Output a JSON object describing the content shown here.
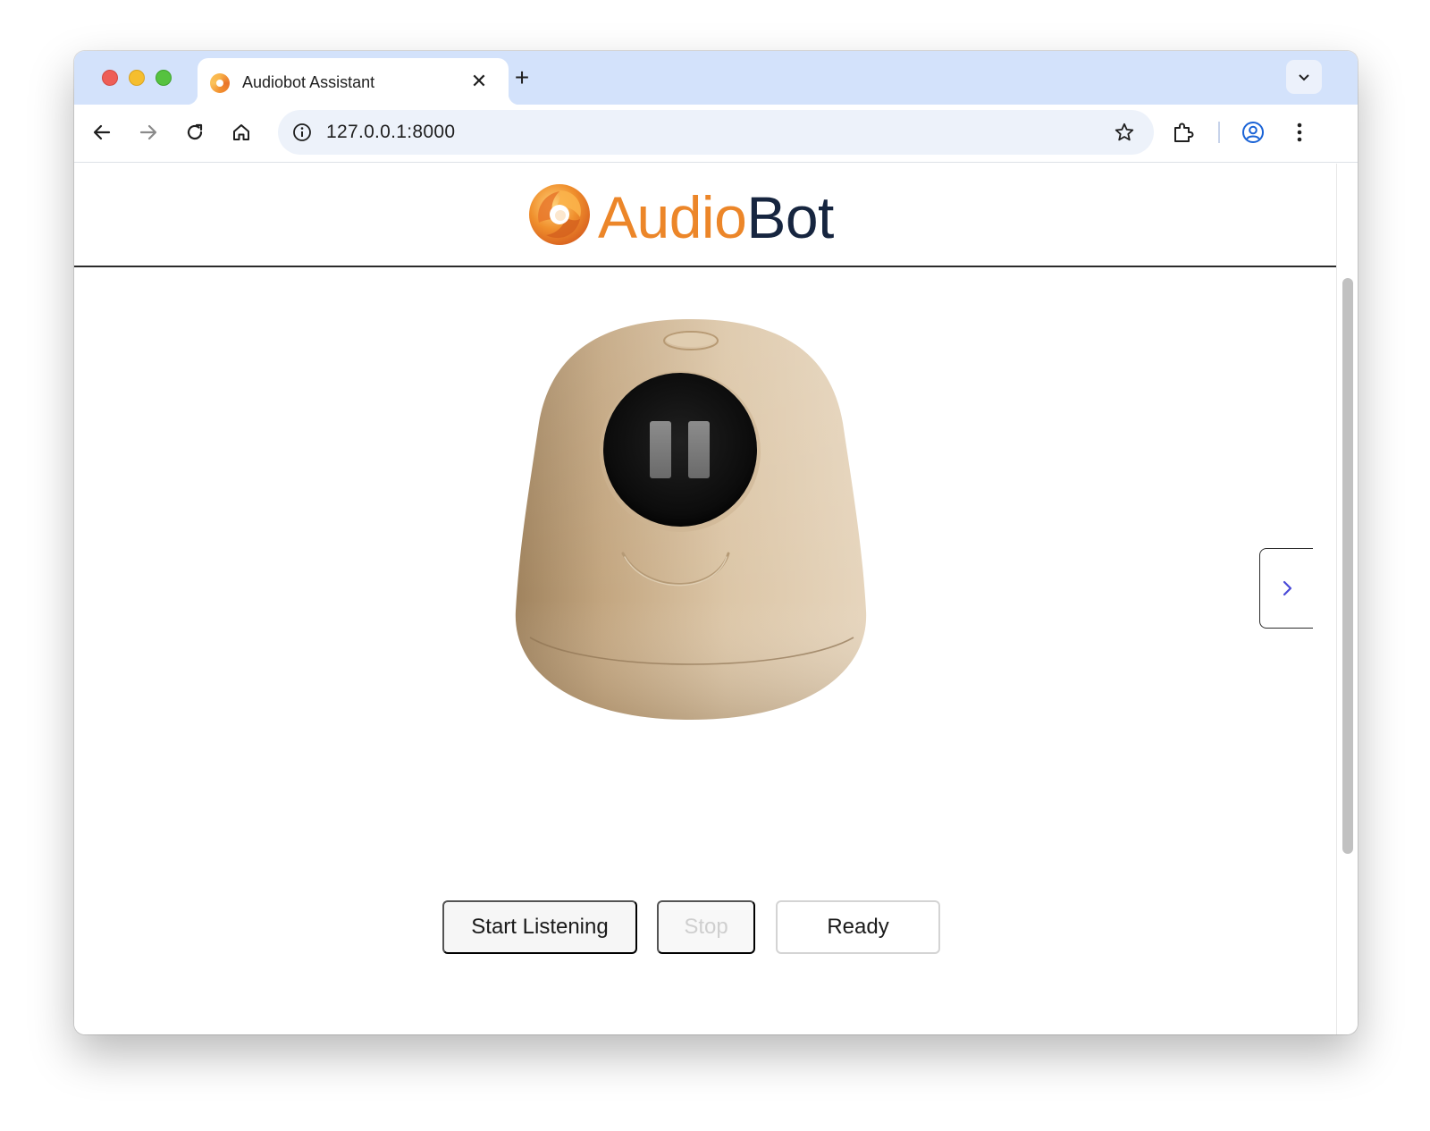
{
  "browser": {
    "tab": {
      "title": "Audiobot Assistant",
      "favicon": "audiobot-logo-icon"
    },
    "url": "127.0.0.1:8000",
    "icons": [
      "back-icon",
      "forward-icon",
      "reload-icon",
      "home-icon",
      "site-info-icon",
      "bookmark-star-icon",
      "extensions-icon",
      "profile-icon",
      "menu-icon",
      "tab-search-icon"
    ]
  },
  "header": {
    "logo_text_audio": "Audio",
    "logo_text_bot": "Bot"
  },
  "controls": {
    "start_label": "Start Listening",
    "stop_label": "Stop",
    "status_label": "Ready"
  },
  "colors": {
    "brand_orange": "#ec8629",
    "brand_navy": "#16253f",
    "tab_strip": "#d3e2fb"
  }
}
